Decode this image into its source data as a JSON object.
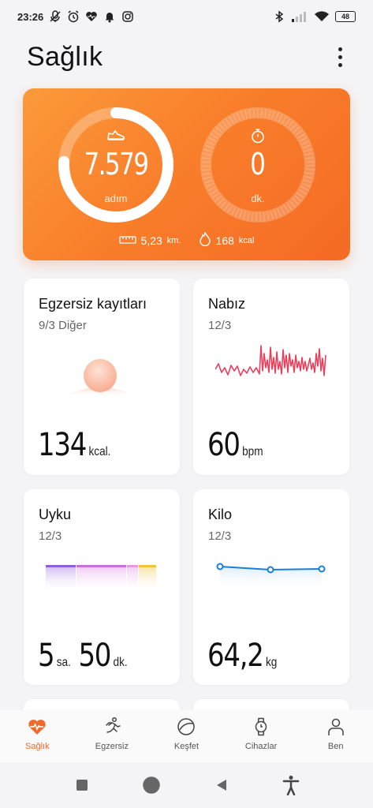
{
  "status_bar": {
    "time": "23:26",
    "battery": "48",
    "icons_left": [
      "muted-mic-icon",
      "alarm-icon",
      "heart-app-icon",
      "bell-icon",
      "instagram-icon"
    ],
    "icons_right": [
      "bluetooth-icon",
      "signal-icon",
      "wifi-icon",
      "battery-icon"
    ]
  },
  "header": {
    "title": "Sağlık"
  },
  "summary": {
    "steps_value": "7.579",
    "steps_unit": "adım",
    "steps_progress": 0.76,
    "minutes_value": "0",
    "minutes_unit": "dk.",
    "distance_value": "5,23",
    "distance_unit": "km.",
    "calories_value": "168",
    "calories_unit": "kcal",
    "colors": {
      "start": "#fb9a3b",
      "end": "#f46a24"
    }
  },
  "tiles": {
    "exercise": {
      "title": "Egzersiz kayıtları",
      "sub": "9/3 Diğer",
      "value": "134",
      "unit": "kcal."
    },
    "heart": {
      "title": "Nabız",
      "sub": "12/3",
      "value": "60",
      "unit": "bpm",
      "color": "#e8405c"
    },
    "sleep": {
      "title": "Uyku",
      "sub": "12/3",
      "hours": "5",
      "hours_unit": "sa.",
      "minutes": "50",
      "minutes_unit": "dk."
    },
    "weight": {
      "title": "Kilo",
      "sub": "12/3",
      "value": "64,2",
      "unit": "kg",
      "color": "#1a7fd8"
    }
  },
  "nav": {
    "items": [
      {
        "label": "Sağlık",
        "icon": "heart-pulse-icon",
        "active": true
      },
      {
        "label": "Egzersiz",
        "icon": "running-icon",
        "active": false
      },
      {
        "label": "Keşfet",
        "icon": "discover-icon",
        "active": false
      },
      {
        "label": "Cihazlar",
        "icon": "watch-icon",
        "active": false
      },
      {
        "label": "Ben",
        "icon": "person-icon",
        "active": false
      }
    ],
    "active_color": "#f06a2a"
  }
}
